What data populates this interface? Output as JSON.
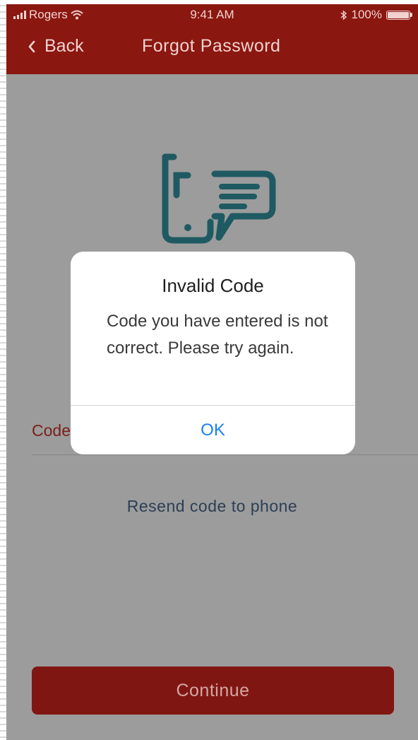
{
  "status_bar": {
    "carrier": "Rogers",
    "time": "9:41 AM",
    "battery": "100%"
  },
  "nav": {
    "back_label": "Back",
    "title": "Forgot Password"
  },
  "form": {
    "code_label": "Code",
    "resend_label": "Resend code to phone",
    "continue_label": "Continue"
  },
  "alert": {
    "title": "Invalid Code",
    "message": "Code you have entered is not correct. Please try again.",
    "ok_label": "OK"
  },
  "colors": {
    "header": "#8a1710",
    "overlay_bg": "#9c9c9c",
    "icon": "#1f5a62",
    "link": "#1a7ef5"
  },
  "icons": {
    "logo": "phone-chat-icon",
    "back": "chevron-left-icon"
  }
}
